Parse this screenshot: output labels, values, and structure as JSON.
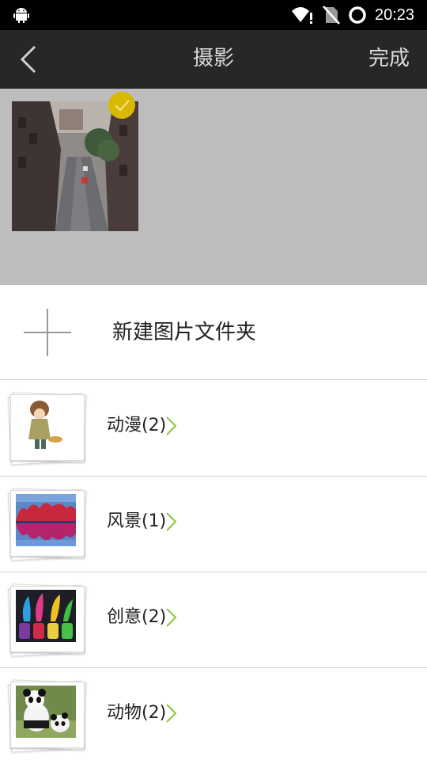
{
  "status_bar": {
    "time": "20:23",
    "icons": [
      "android-icon",
      "wifi-icon",
      "no-sim-icon",
      "battery-ring-icon"
    ]
  },
  "header": {
    "title": "摄影",
    "done_label": "完成"
  },
  "selected": {
    "items": [
      {
        "icon": "street-photo",
        "selected": true
      }
    ],
    "accent_color": "#d8b800"
  },
  "new_folder": {
    "label": "新建图片文件夹"
  },
  "albums": [
    {
      "label": "动漫(2)",
      "thumbnail": "anime-girl"
    },
    {
      "label": "风景(1)",
      "thumbnail": "red-forest-lake"
    },
    {
      "label": "创意(2)",
      "thumbnail": "color-splash-jars"
    },
    {
      "label": "动物(2)",
      "thumbnail": "pandas"
    }
  ],
  "colors": {
    "status_bar": "#000000",
    "title_bar": "#272727",
    "selected_area": "#bdbdbd",
    "chevron": "#8cc63f"
  }
}
